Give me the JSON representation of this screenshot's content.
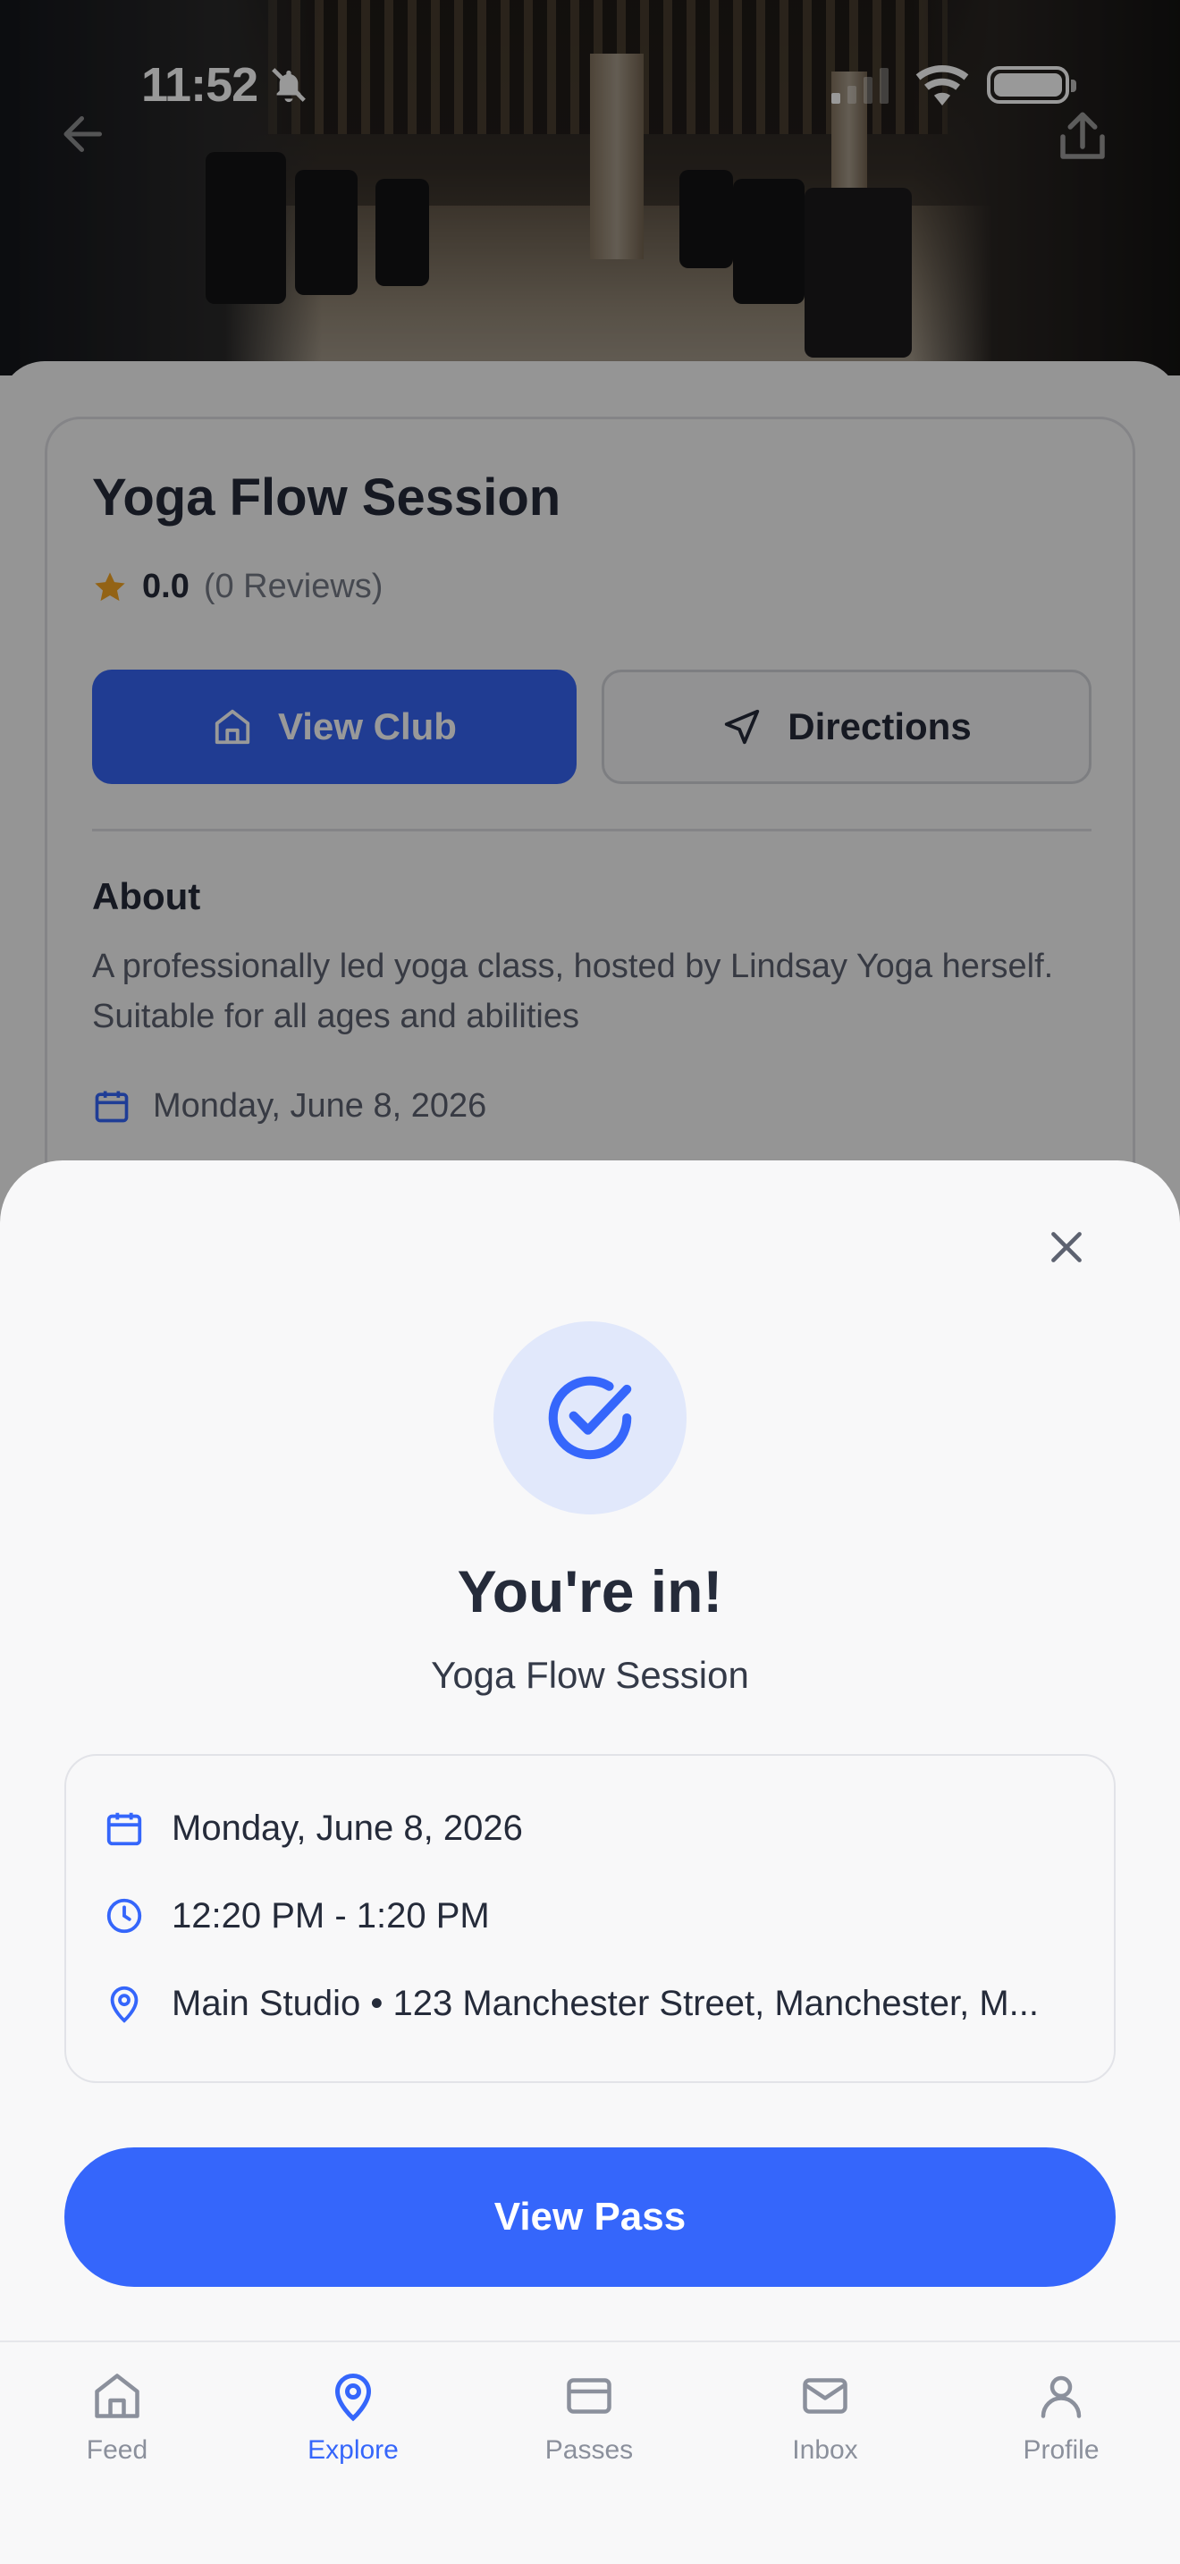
{
  "status_bar": {
    "time": "11:52"
  },
  "club": {
    "title": "Yoga Flow Session",
    "rating": "0.0",
    "reviews": "(0 Reviews)",
    "view_club_label": "View Club",
    "directions_label": "Directions",
    "about_heading": "About",
    "about_text": "A professionally led yoga class, hosted by Lindsay Yoga herself. Suitable for all ages and abilities",
    "date": "Monday, June 8, 2026"
  },
  "sheet": {
    "title": "You're in!",
    "subtitle": "Yoga Flow Session",
    "date": "Monday, June 8, 2026",
    "time": "12:20 PM - 1:20 PM",
    "location": "Main Studio • 123 Manchester Street, Manchester, M...",
    "view_pass_label": "View Pass"
  },
  "tabs": [
    {
      "label": "Feed",
      "icon": "home-icon",
      "active": false
    },
    {
      "label": "Explore",
      "icon": "map-pin-icon",
      "active": true
    },
    {
      "label": "Passes",
      "icon": "card-icon",
      "active": false
    },
    {
      "label": "Inbox",
      "icon": "mail-icon",
      "active": false
    },
    {
      "label": "Profile",
      "icon": "user-icon",
      "active": false
    }
  ],
  "colors": {
    "accent": "#3566fb",
    "rating_star": "#f5a623",
    "text_primary": "#252b3a",
    "text_muted": "#8b909c"
  }
}
